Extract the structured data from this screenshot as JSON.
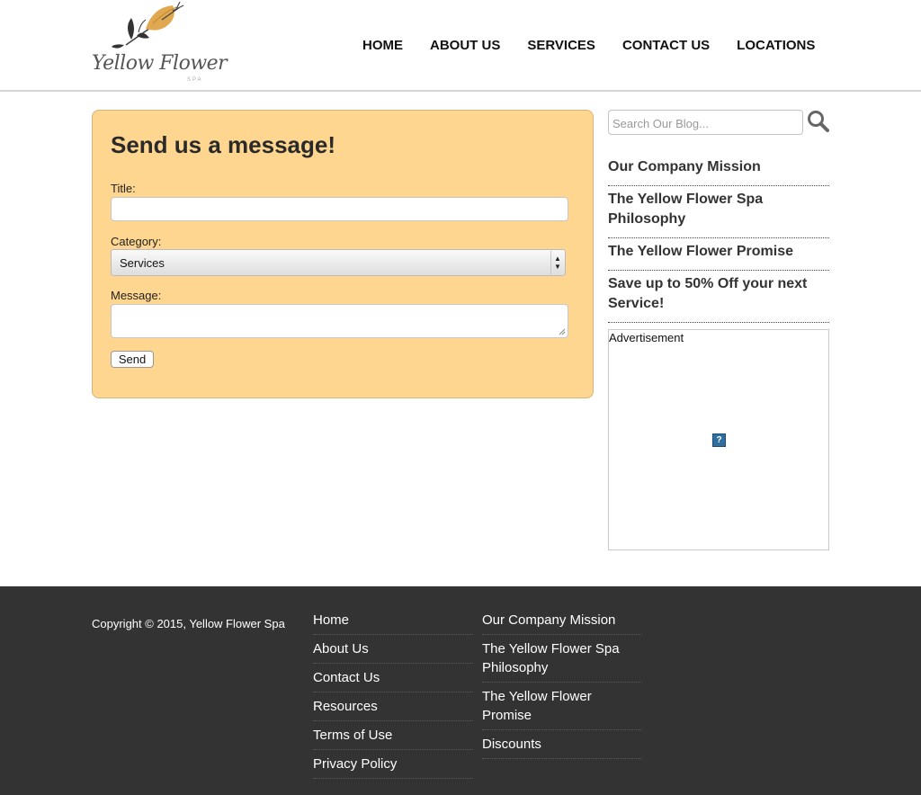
{
  "brand": {
    "name": "Yellow Flower",
    "sub": "SPA"
  },
  "nav": [
    {
      "label": "HOME"
    },
    {
      "label": "ABOUT US"
    },
    {
      "label": "SERVICES"
    },
    {
      "label": "CONTACT US"
    },
    {
      "label": "LOCATIONS"
    }
  ],
  "form": {
    "heading": "Send us a message!",
    "title_label": "Title:",
    "title_value": "",
    "category_label": "Category:",
    "category_value": "Services",
    "message_label": "Message:",
    "message_value": "",
    "send_label": "Send"
  },
  "sidebar": {
    "search_placeholder": "Search Our Blog...",
    "links": [
      {
        "label": "Our Company Mission"
      },
      {
        "label": "The Yellow Flower Spa Philosophy"
      },
      {
        "label": "The Yellow Flower Promise"
      },
      {
        "label": "Save up to 50% Off your next Service!"
      }
    ],
    "ad_label": "Advertisement",
    "ad_placeholder": "?"
  },
  "footer": {
    "copyright": "Copyright © 2015, Yellow Flower Spa",
    "col1": [
      {
        "label": "Home"
      },
      {
        "label": "About Us"
      },
      {
        "label": "Contact Us"
      },
      {
        "label": "Resources"
      },
      {
        "label": "Terms of Use"
      },
      {
        "label": "Privacy Policy"
      }
    ],
    "col2": [
      {
        "label": "Our Company Mission"
      },
      {
        "label": "The Yellow Flower Spa Philosophy"
      },
      {
        "label": "The Yellow Flower Promise"
      },
      {
        "label": "Discounts"
      }
    ]
  },
  "colors": {
    "panel": "#ffd690",
    "footer": "#333333",
    "accent": "#e0a850"
  }
}
